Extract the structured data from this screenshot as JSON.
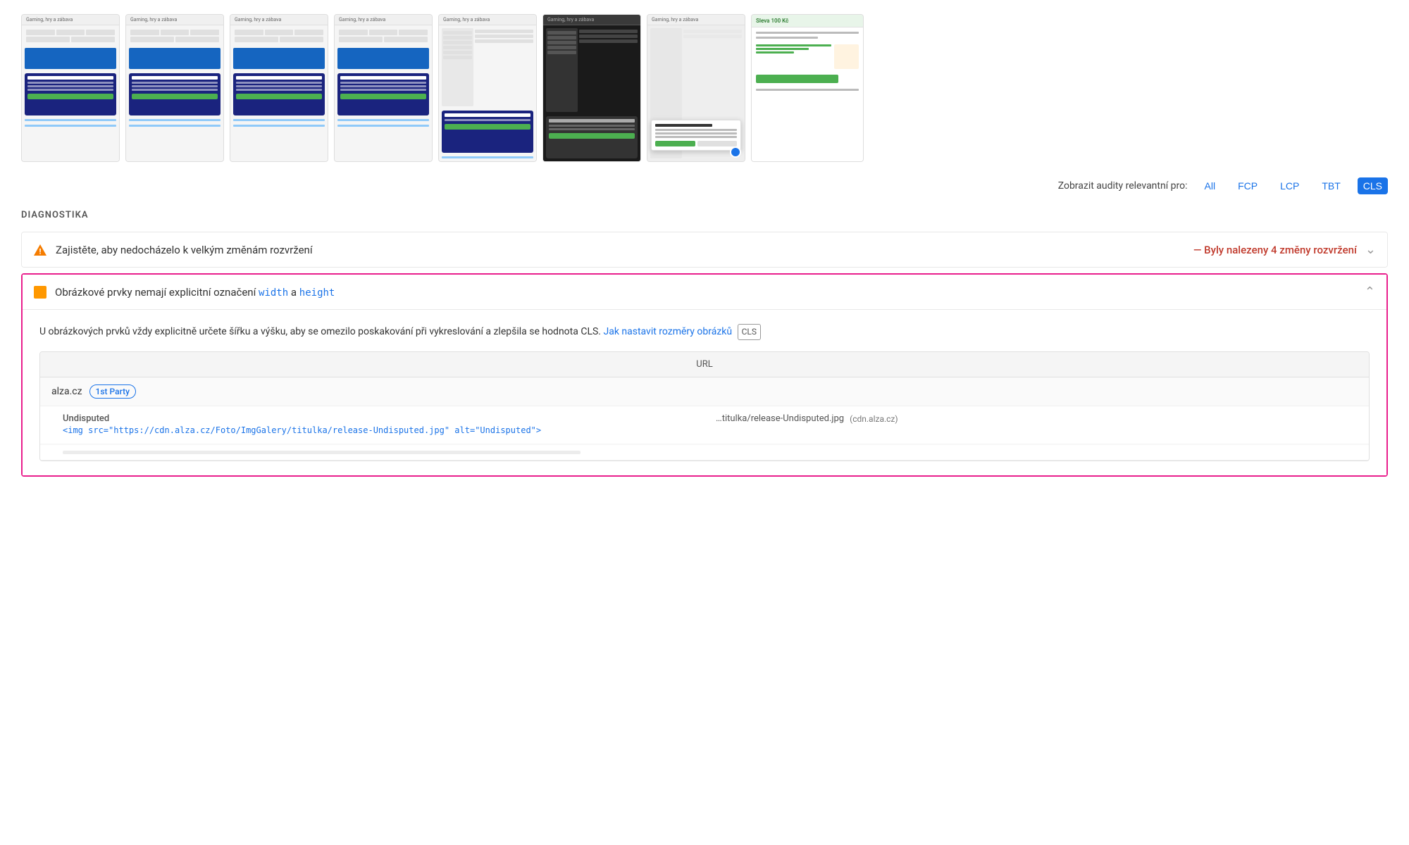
{
  "filmstrip": {
    "items": [
      {
        "id": 1,
        "type": "standard",
        "header": "Gaming, hry a zábava"
      },
      {
        "id": 2,
        "type": "standard",
        "header": "Gaming, hry a zábava"
      },
      {
        "id": 3,
        "type": "standard",
        "header": "Gaming, hry a zábava"
      },
      {
        "id": 4,
        "type": "standard",
        "header": "Gaming, hry a zábava"
      },
      {
        "id": 5,
        "type": "standard",
        "header": "Gaming, hry a zábava"
      },
      {
        "id": 6,
        "type": "dark",
        "header": "Gaming, hry a zábava"
      },
      {
        "id": 7,
        "type": "overlay",
        "header": "Gaming, hry a zábava"
      },
      {
        "id": 8,
        "type": "promo",
        "header": "Sleva 100 Kč"
      }
    ]
  },
  "audit_filter": {
    "label": "Zobrazit audity relevantní pro:",
    "buttons": [
      "All",
      "FCP",
      "LCP",
      "TBT",
      "CLS"
    ],
    "active": "CLS"
  },
  "diagnostika": {
    "title": "DIAGNOSTIKA",
    "items": [
      {
        "id": "layout-shifts",
        "icon": "warning",
        "title": "Zajistěte, aby nedocházelo k velkým změnám rozvržení",
        "detail": "— Byly nalezeny 4 změny rozvržení",
        "expanded": false
      },
      {
        "id": "image-dimensions",
        "icon": "orange-square",
        "title_before": "Obrázkové prvky nemají explicitní označení ",
        "title_code1": "width",
        "title_middle": " a ",
        "title_code2": "height",
        "expanded": true
      }
    ]
  },
  "expanded_audit": {
    "description_part1": "U obrázkových prvků vždy explicitně určete šířku a výšku, aby se omezilo poskakování při vykreslování a zlepšila se hodnota CLS.",
    "description_link": "Jak nastavit rozměry obrázků",
    "description_badge": "CLS",
    "table": {
      "header": "URL",
      "domain_row": {
        "name": "alza.cz",
        "badge": "1st Party"
      },
      "items": [
        {
          "label": "Undisputed",
          "code": "<img src=\"https://cdn.alza.cz/Foto/ImgGalery/titulka/release-Undisputed.jpg\" alt=\"Undisputed\">",
          "url_display": "…titulka/release-Undisputed.jpg",
          "cdn": "(cdn.alza.cz)"
        }
      ]
    }
  }
}
